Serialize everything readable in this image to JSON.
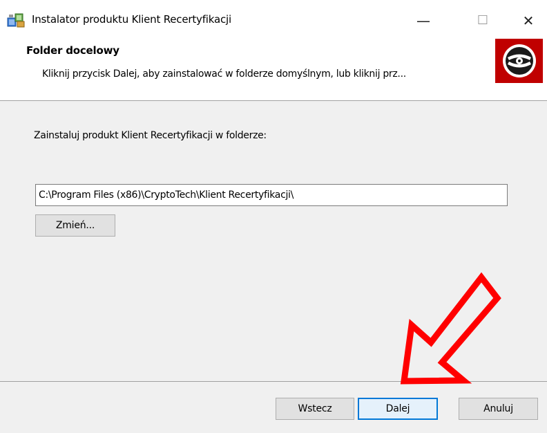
{
  "window": {
    "title": "Instalator produktu Klient Recertyfikacji",
    "minimize_glyph": "—",
    "maximize_glyph": "☐",
    "close_glyph": "✕"
  },
  "header": {
    "title": "Folder docelowy",
    "subtitle": "Kliknij przycisk Dalej, aby zainstalować w folderze domyślnym, lub kliknij prz...",
    "logo_icon": "disc-icon",
    "logo_bg_color": "#c00000"
  },
  "body": {
    "install_label": "Zainstaluj produkt Klient Recertyfikacji w folderze:",
    "install_path": "C:\\Program Files (x86)\\CryptoTech\\Klient Recertyfikacji\\",
    "change_button": "Zmień..."
  },
  "footer": {
    "back_button": "Wstecz",
    "next_button": "Dalej",
    "cancel_button": "Anuluj"
  },
  "annotation": {
    "arrow_color": "#ff0000",
    "arrow_icon": "arrow-down-left-icon"
  }
}
